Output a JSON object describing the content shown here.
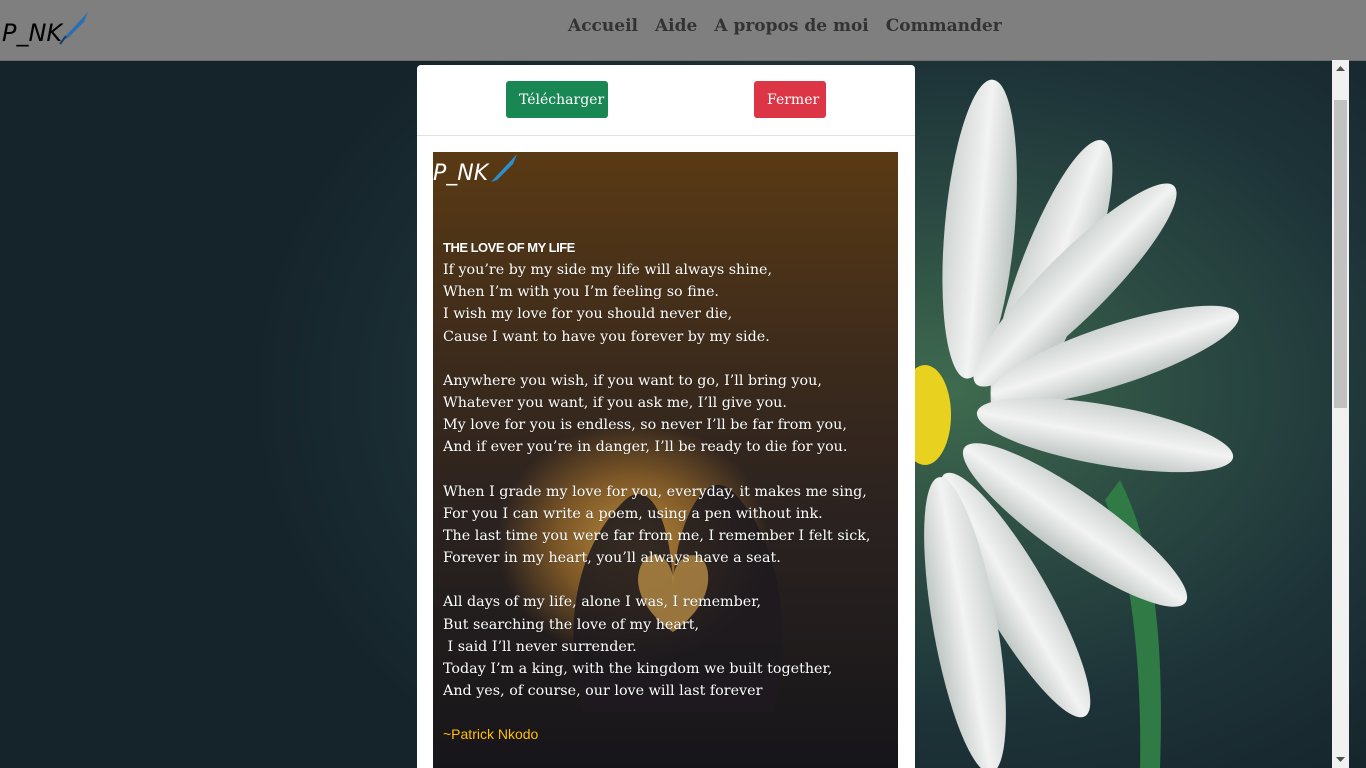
{
  "navbar": {
    "brand": "P_NK",
    "links": [
      "Accueil",
      "Aide",
      "A propos de moi",
      "Commander"
    ]
  },
  "modal": {
    "download_label": "Télécharger",
    "close_label": "Fermer",
    "card_brand": "P_NK",
    "poem": {
      "title": "THE LOVE OF MY LIFE",
      "stanzas": [
        "If you’re by my side my life will always shine,\nWhen I’m with you I’m feeling so fine.\nI wish my love for you should never die,\nCause I want to have you forever by my side.",
        "Anywhere you wish, if you want to go, I’ll bring you,\nWhatever you want, if you ask me, I’ll give you.\nMy love for you is endless, so never I’ll be far from you,\nAnd if ever you’re in danger, I’ll be ready to die for you.",
        "When I grade my love for you, everyday, it makes me sing,\nFor you I can write a poem, using a pen without ink.\nThe last time you were far from me, I remember I felt sick,\nForever in my heart, you’ll always have a seat.",
        "All days of my life, alone I was, I remember,\nBut searching the love of my heart,\n I said I’ll never surrender.\nToday I’m a king, with the kingdom we built together,\nAnd yes, of course, our love will last forever"
      ],
      "author": "~Patrick Nkodo"
    }
  },
  "colors": {
    "download": "#198754",
    "close": "#dc3545",
    "author": "#ffc107",
    "navbar_dimmed": "#7f7f7f"
  },
  "icons": {
    "brand_logo": "quill-pen-logo",
    "scroll_up": "triangle-up-icon",
    "scroll_down": "triangle-down-icon"
  }
}
